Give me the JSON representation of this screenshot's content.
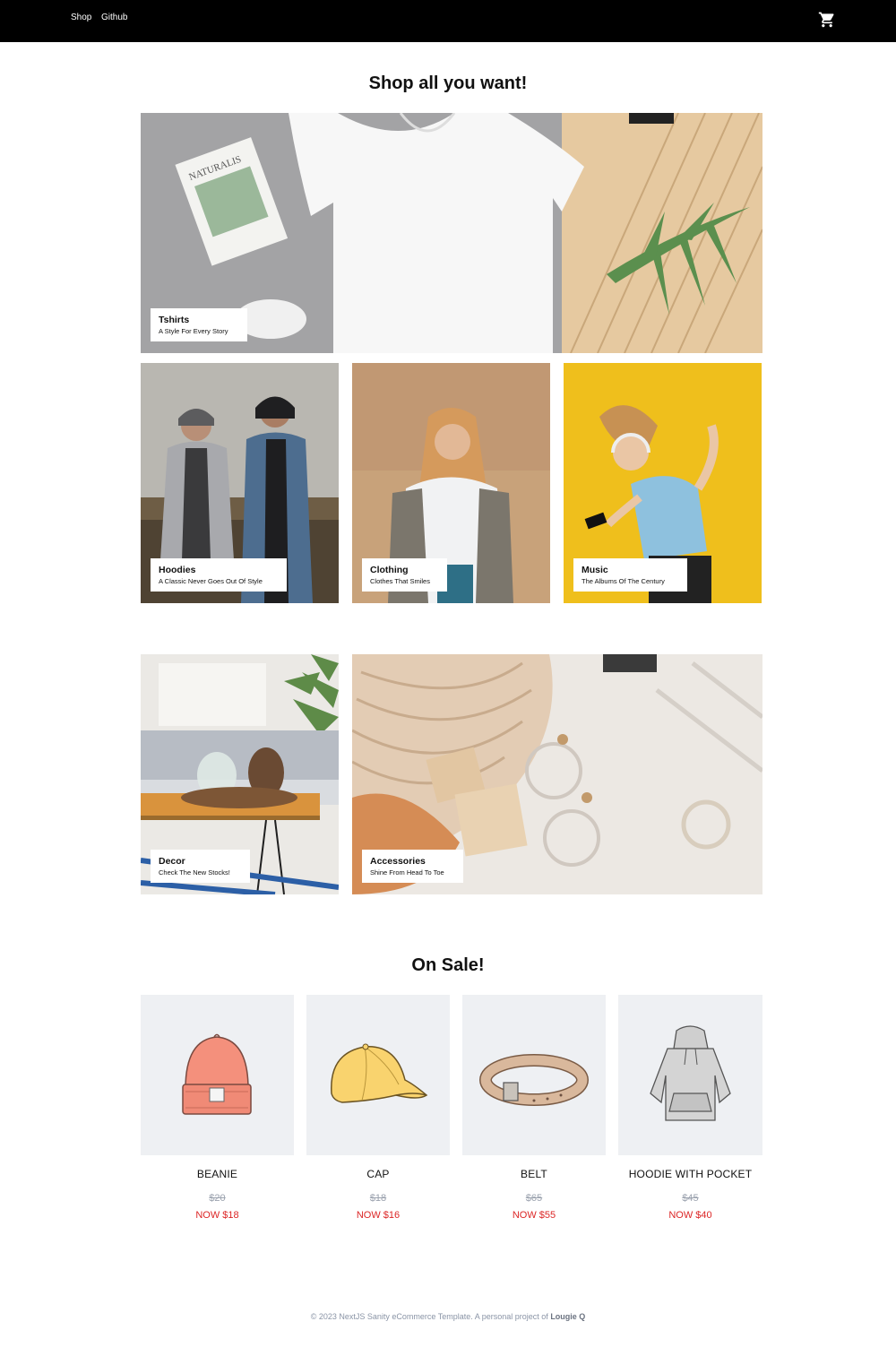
{
  "nav": {
    "links": [
      "Shop",
      "Github"
    ],
    "cart_icon": "cart-icon"
  },
  "hero": {
    "title": "Shop all you want!"
  },
  "categories": [
    {
      "title": "Tshirts",
      "subtitle": "A Style For Every Story"
    },
    {
      "title": "Hoodies",
      "subtitle": "A Classic Never Goes Out Of Style"
    },
    {
      "title": "Clothing",
      "subtitle": "Clothes That Smiles"
    },
    {
      "title": "Music",
      "subtitle": "The Albums Of The Century"
    },
    {
      "title": "Decor",
      "subtitle": "Check The New Stocks!"
    },
    {
      "title": "Accessories",
      "subtitle": "Shine From Head To Toe"
    }
  ],
  "sale": {
    "title": "On Sale!",
    "products": [
      {
        "name": "BEANIE",
        "old_price": "$20",
        "new_price": "NOW $18",
        "icon": "beanie-icon"
      },
      {
        "name": "CAP",
        "old_price": "$18",
        "new_price": "NOW $16",
        "icon": "cap-icon"
      },
      {
        "name": "BELT",
        "old_price": "$65",
        "new_price": "NOW $55",
        "icon": "belt-icon"
      },
      {
        "name": "HOODIE WITH POCKET",
        "old_price": "$45",
        "new_price": "NOW $40",
        "icon": "hoodie-icon"
      }
    ]
  },
  "footer": {
    "text": "© 2023 NextJS Sanity eCommerce Template. A personal project of",
    "author": "Lougie Q"
  },
  "colors": {
    "navbar": "#000000",
    "sale_price": "#dc2626",
    "old_price": "#9ca3af",
    "product_bg": "#eef0f3"
  }
}
